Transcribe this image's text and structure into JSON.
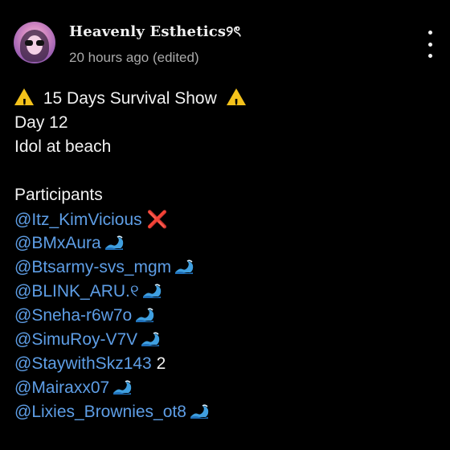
{
  "post": {
    "username": "Heavenly Esthetics୨ৎ",
    "timestamp": "20 hours ago (edited)",
    "menu_icon": "more-vertical-icon"
  },
  "comment": {
    "title": "15 Days Survival Show",
    "day": "Day 12",
    "theme": "Idol at beach",
    "participants_header": "Participants",
    "participants": [
      {
        "handle": "@Itz_KimVicious",
        "status": "cross"
      },
      {
        "handle": "@BMxAura",
        "status": "wave"
      },
      {
        "handle": "@Btsarmy-svs_mgm",
        "status": "wave"
      },
      {
        "handle": "@BLINK_ARU.୧",
        "status": "wave"
      },
      {
        "handle": "@Sneha-r6w7o",
        "status": "wave"
      },
      {
        "handle": "@SimuRoy-V7V",
        "status": "wave"
      },
      {
        "handle": "@StaywithSkz143",
        "status": "text",
        "status_text": "2"
      },
      {
        "handle": "@Mairaxx07",
        "status": "wave"
      },
      {
        "handle": "@Lixies_Brownies_ot8",
        "status": "wave"
      }
    ],
    "cross_symbol": "❌"
  },
  "colors": {
    "background": "#000000",
    "text": "#f1f1f1",
    "secondary_text": "#aaaaaa",
    "mention": "#5e9ee6",
    "warning": "#f4c21b",
    "cross": "#e53935",
    "wave": "#3f9fe0"
  }
}
